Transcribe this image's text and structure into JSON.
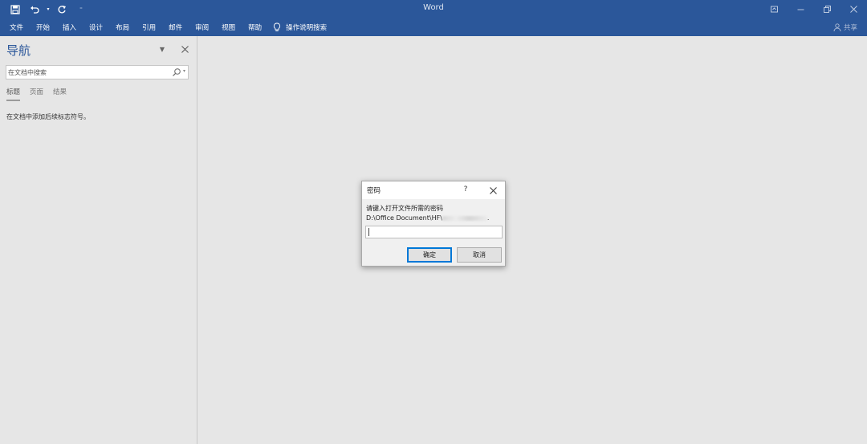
{
  "app": {
    "title": "Word"
  },
  "ribbon": {
    "tabs": [
      "文件",
      "开始",
      "插入",
      "设计",
      "布局",
      "引用",
      "邮件",
      "审阅",
      "视图",
      "帮助"
    ],
    "tell_me": "操作说明搜索",
    "share": "共享"
  },
  "nav_pane": {
    "title": "导航",
    "search_placeholder": "在文档中搜索",
    "tabs": [
      "标题",
      "页面",
      "结果"
    ],
    "hint": "在文档中添加后续标志符号。"
  },
  "dialog": {
    "title": "密码",
    "help": "?",
    "prompt": "请键入打开文件所需的密码",
    "path": "D:\\Office Document\\HF\\",
    "path_suffix": ".",
    "password_value": "",
    "ok_label": "确定",
    "cancel_label": "取消"
  },
  "colors": {
    "ribbon_blue": "#2b579a",
    "background": "#e6e6e6",
    "dialog_bg": "#f0f0f0",
    "focus_blue": "#0078d7"
  },
  "icons": {
    "qat": [
      "save-icon",
      "undo-icon",
      "redo-icon",
      "customize-qat-icon"
    ],
    "window": [
      "ribbon-display-options-icon",
      "minimize-icon",
      "restore-icon",
      "close-icon"
    ]
  }
}
